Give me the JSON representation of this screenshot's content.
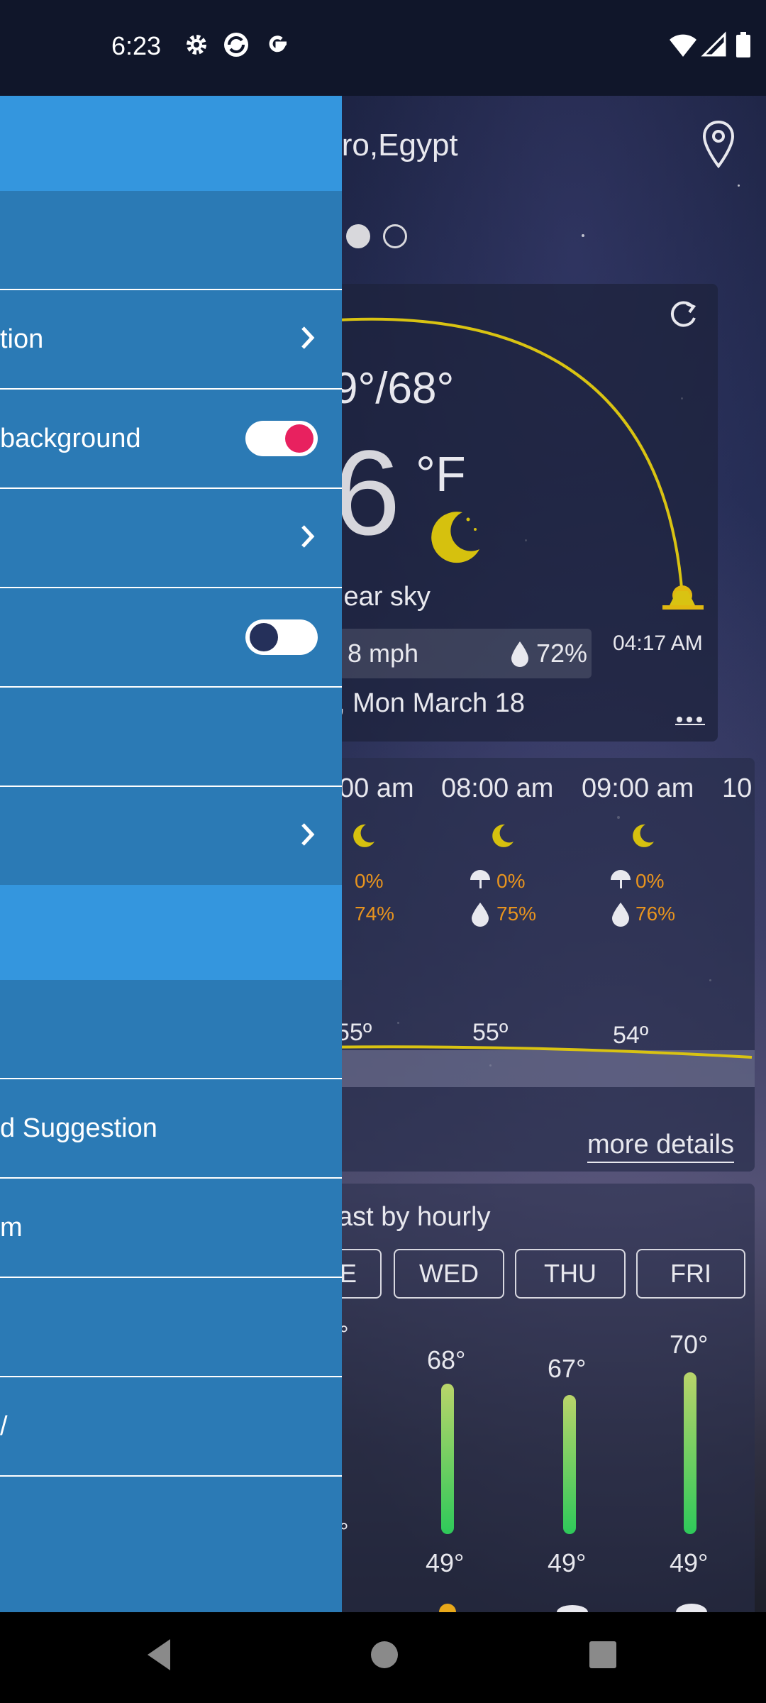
{
  "status_bar": {
    "time": "6:23"
  },
  "weather": {
    "city": "iro,Egypt",
    "temp_range": "9°/68°",
    "temp": "6",
    "unit": "°F",
    "condition": "lear sky",
    "wind": "8 mph",
    "humidity": "72%",
    "sun_time": "04:17 AM",
    "date": ", Mon March 18",
    "more_icon": "ellipsis-icon",
    "hourly": [
      {
        "time": "00 am",
        "rain": "0%",
        "hum": "74%",
        "temp": "55º"
      },
      {
        "time": "08:00 am",
        "rain": "0%",
        "hum": "75%",
        "temp": "55º"
      },
      {
        "time": "09:00 am",
        "rain": "0%",
        "hum": "76%",
        "temp": "54º"
      }
    ],
    "hourly_partial": "10",
    "more_details": "more details",
    "forecast_title": "ast by hourly",
    "day_tabs": [
      "E",
      "WED",
      "THU",
      "FRI"
    ],
    "daily": [
      {
        "high": "68°",
        "low": "49°"
      },
      {
        "high": "67°",
        "low": "49°"
      },
      {
        "high": "70°",
        "low": "49°"
      }
    ],
    "partial_high": "°",
    "partial_low": "°"
  },
  "drawer": {
    "items": [
      {
        "label": "",
        "control": "none"
      },
      {
        "label": "tion",
        "control": "chevron"
      },
      {
        "label": "background",
        "control": "toggle-on"
      },
      {
        "label": "",
        "control": "chevron"
      },
      {
        "label": "",
        "control": "toggle-off"
      },
      {
        "label": "",
        "control": "none"
      },
      {
        "label": "",
        "control": "chevron"
      }
    ],
    "items2": [
      {
        "label": ""
      },
      {
        "label": "d Suggestion"
      },
      {
        "label": "m"
      },
      {
        "label": ""
      },
      {
        "label": "/"
      }
    ]
  },
  "colors": {
    "drawer_bg": "#2b7ab5",
    "drawer_header": "#3496de",
    "toggle_on": "#e8215f",
    "toggle_off": "#25305a",
    "sun_arc": "#d9c312"
  }
}
